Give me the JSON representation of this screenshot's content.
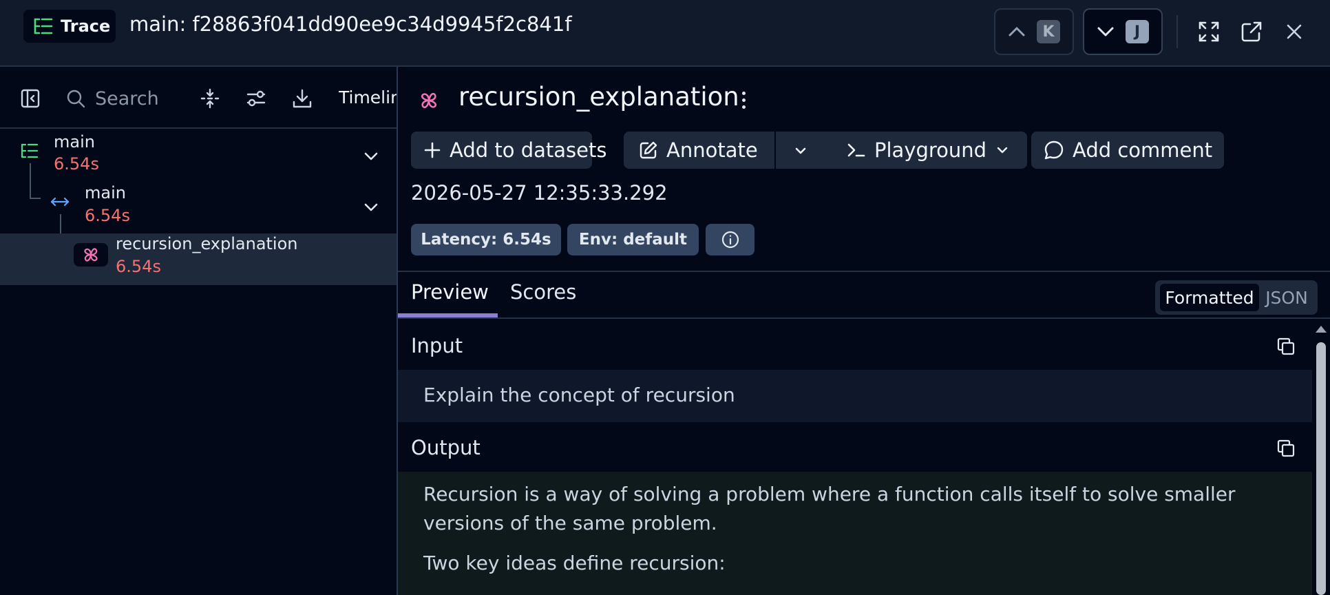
{
  "header": {
    "badge_label": "Trace",
    "trace_title": "main: f28863f041dd90ee9c34d9945f2c841f",
    "prev_key": "K",
    "next_key": "J"
  },
  "toolbar": {
    "search_placeholder": "Search",
    "timeline_label": "Timelin"
  },
  "tree": [
    {
      "name": "main",
      "duration": "6.54s",
      "type": "trace"
    },
    {
      "name": "main",
      "duration": "6.54s",
      "type": "span"
    },
    {
      "name": "recursion_explanation",
      "duration": "6.54s",
      "type": "llm"
    }
  ],
  "span": {
    "title": "recursion_explanation",
    "timestamp": "2026-05-27 12:35:33.292",
    "actions": {
      "add_datasets": "Add to datasets",
      "annotate": "Annotate",
      "playground": "Playground",
      "add_comment": "Add comment"
    },
    "badges": {
      "latency": "Latency: 6.54s",
      "env": "Env: default"
    }
  },
  "tabs": {
    "preview": "Preview",
    "scores": "Scores"
  },
  "view_toggle": {
    "formatted": "Formatted",
    "json": "JSON"
  },
  "input": {
    "label": "Input",
    "text": "Explain the concept of recursion"
  },
  "output": {
    "label": "Output",
    "line1": "Recursion is a way of solving a problem where a function calls itself to solve smaller",
    "line2": "versions of the same problem.",
    "line3": "Two key ideas define recursion:"
  },
  "colors": {
    "trace_icon": "#4ade80",
    "span_icon": "#60a5fa",
    "llm_icon": "#f472b6",
    "duration": "#f87171",
    "tab_accent": "#8b7fd4"
  }
}
